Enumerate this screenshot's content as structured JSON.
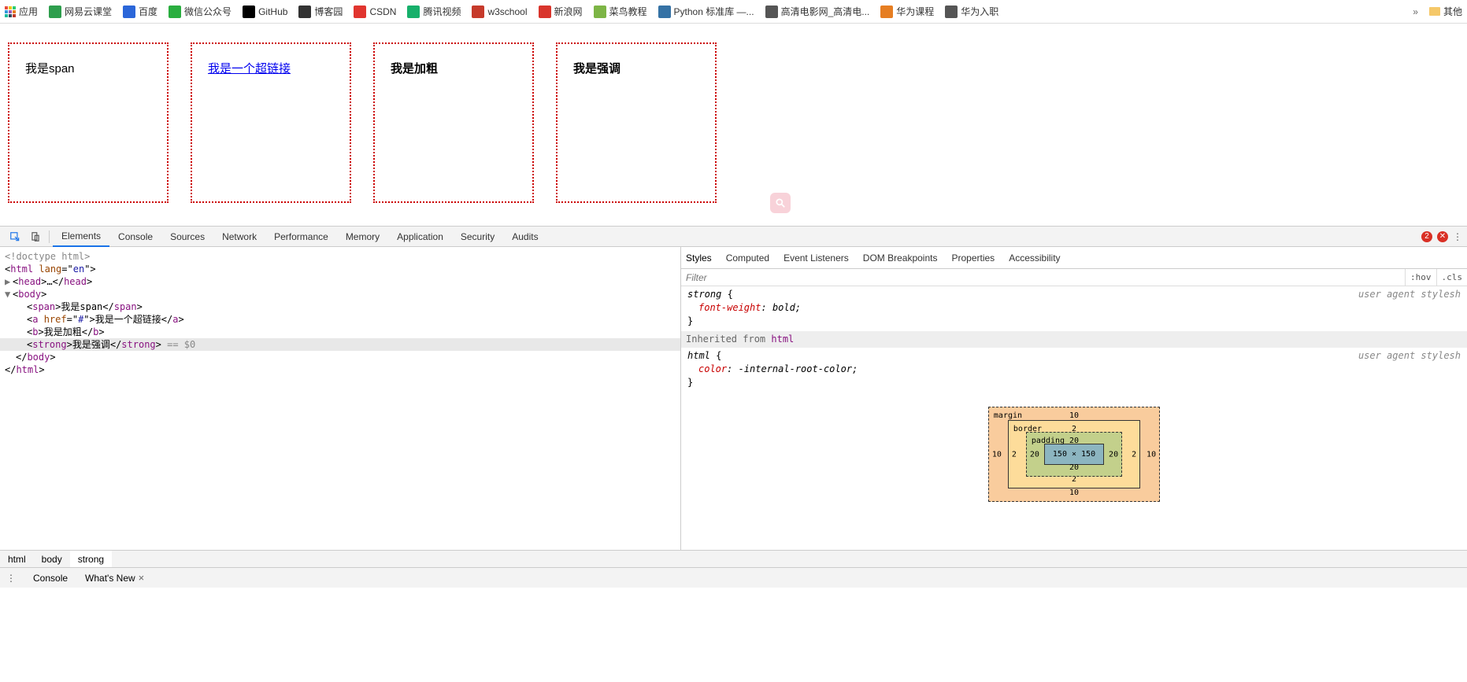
{
  "bookmarks": {
    "apps": "应用",
    "items": [
      {
        "label": "网易云课堂",
        "color": "#2e9e4d"
      },
      {
        "label": "百度",
        "color": "#2b66d9"
      },
      {
        "label": "微信公众号",
        "color": "#2aae3f"
      },
      {
        "label": "GitHub",
        "color": "#000"
      },
      {
        "label": "博客园",
        "color": "#333"
      },
      {
        "label": "CSDN",
        "color": "#e1352f"
      },
      {
        "label": "腾讯视频",
        "color": "#17b06b"
      },
      {
        "label": "w3school",
        "color": "#c63a2b"
      },
      {
        "label": "新浪网",
        "color": "#d9352c"
      },
      {
        "label": "菜鸟教程",
        "color": "#7db546"
      },
      {
        "label": "Python 标准库 —...",
        "color": "#3572A5"
      },
      {
        "label": "高清电影网_高清电...",
        "color": "#555"
      },
      {
        "label": "华为课程",
        "color": "#e67e22"
      },
      {
        "label": "华为入职",
        "color": "#555"
      }
    ],
    "other": "其他"
  },
  "page": {
    "box1": "我是span",
    "box2": "我是一个超链接",
    "box3": "我是加粗",
    "box4": "我是强调"
  },
  "devtools": {
    "tabs": [
      "Elements",
      "Console",
      "Sources",
      "Network",
      "Performance",
      "Memory",
      "Application",
      "Security",
      "Audits"
    ],
    "errors": "2",
    "source": {
      "doctype": "<!doctype html>",
      "html_open": {
        "t": "html",
        "a": "lang",
        "v": "en"
      },
      "head": "…",
      "body": "body",
      "span": {
        "tag": "span",
        "txt": "我是span"
      },
      "a": {
        "tag": "a",
        "an": "href",
        "av": "#",
        "txt": "我是一个超链接"
      },
      "b": {
        "tag": "b",
        "txt": "我是加粗"
      },
      "strong": {
        "tag": "strong",
        "txt": "我是强调",
        "eq": " == $0"
      }
    },
    "styles_tabs": [
      "Styles",
      "Computed",
      "Event Listeners",
      "DOM Breakpoints",
      "Properties",
      "Accessibility"
    ],
    "filter_placeholder": "Filter",
    "hov": ":hov",
    "cls": ".cls",
    "uas": "user agent stylesh",
    "rule1": {
      "sel": "strong",
      "prop": "font-weight",
      "val": "bold"
    },
    "inherit_label": "Inherited from ",
    "inherit_tag": "html",
    "rule2": {
      "sel": "html",
      "prop": "color",
      "val": "-internal-root-color"
    },
    "boxmodel": {
      "margin_label": "margin",
      "margin_v": "10",
      "border_label": "border",
      "border_v": "2",
      "padding_label": "padding",
      "padding_v": "20",
      "content": "150 × 150"
    },
    "breadcrumb": [
      "html",
      "body",
      "strong"
    ],
    "drawer": {
      "console": "Console",
      "whatsnew": "What's New"
    }
  }
}
